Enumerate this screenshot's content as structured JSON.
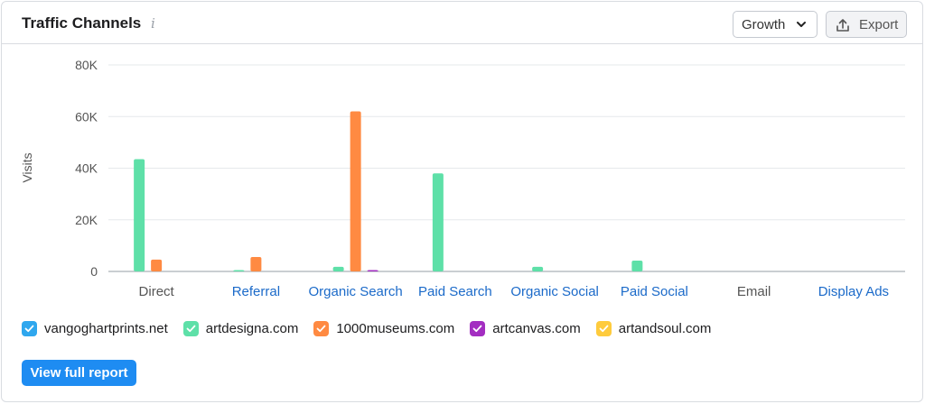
{
  "header": {
    "title": "Traffic Channels",
    "info_icon": "i",
    "dropdown_value": "Growth",
    "export_label": "Export"
  },
  "colors": {
    "vangoghartprints": "#2fa7ee",
    "artdesigna": "#5ee0a8",
    "museums": "#ff8a42",
    "artcanvas": "#a32ec1",
    "artandsoul": "#fecb3d",
    "link": "#1b6ac9"
  },
  "legend": [
    {
      "label": "vangoghartprints.net",
      "color": "#2fa7ee"
    },
    {
      "label": "artdesigna.com",
      "color": "#5ee0a8"
    },
    {
      "label": "1000museums.com",
      "color": "#ff8a42"
    },
    {
      "label": "artcanvas.com",
      "color": "#a32ec1"
    },
    {
      "label": "artandsoul.com",
      "color": "#fecb3d"
    }
  ],
  "report_button": "View full report",
  "chart_data": {
    "type": "bar",
    "ylabel": "Visits",
    "ylim": [
      0,
      80000
    ],
    "yticks": [
      0,
      20000,
      40000,
      60000,
      80000
    ],
    "ytick_labels": [
      "0",
      "20K",
      "40K",
      "60K",
      "80K"
    ],
    "categories": [
      "Direct",
      "Referral",
      "Organic Search",
      "Paid Search",
      "Organic Social",
      "Paid Social",
      "Email",
      "Display Ads"
    ],
    "category_links": [
      false,
      true,
      true,
      true,
      true,
      true,
      false,
      true
    ],
    "grid": true,
    "legend_position": "bottom",
    "series": [
      {
        "name": "vangoghartprints.net",
        "color": "#2fa7ee",
        "values": [
          0,
          0,
          0,
          0,
          0,
          0,
          0,
          0
        ]
      },
      {
        "name": "artdesigna.com",
        "color": "#5ee0a8",
        "values": [
          43500,
          400,
          1800,
          38000,
          1800,
          4200,
          0,
          0
        ]
      },
      {
        "name": "1000museums.com",
        "color": "#ff8a42",
        "values": [
          4600,
          5600,
          62000,
          0,
          0,
          0,
          0,
          0
        ]
      },
      {
        "name": "artcanvas.com",
        "color": "#a32ec1",
        "values": [
          0,
          0,
          300,
          0,
          0,
          0,
          0,
          0
        ]
      },
      {
        "name": "artandsoul.com",
        "color": "#fecb3d",
        "values": [
          0,
          0,
          0,
          0,
          0,
          0,
          0,
          0
        ]
      }
    ]
  }
}
